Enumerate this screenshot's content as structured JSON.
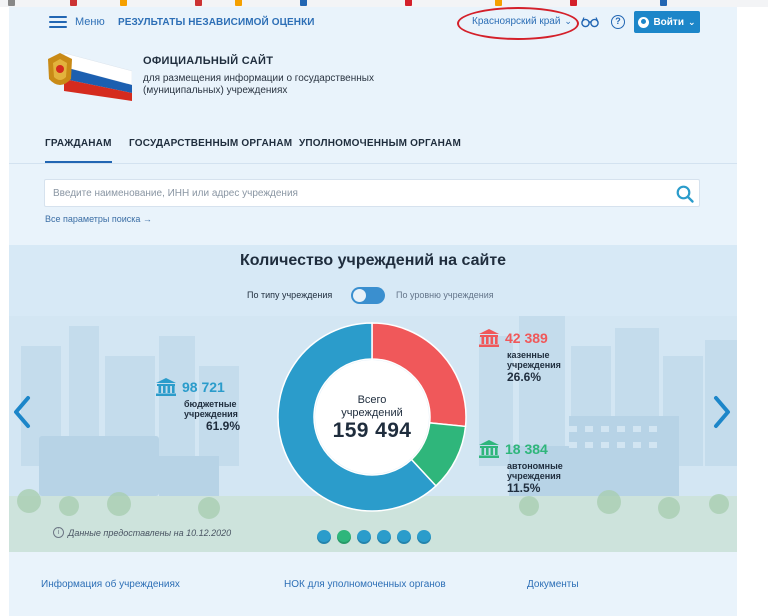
{
  "header": {
    "menu_label": "Меню",
    "results_link": "РЕЗУЛЬТАТЫ НЕЗАВИСИМОЙ ОЦЕНКИ",
    "region": "Красноярский край",
    "help_symbol": "?",
    "login_label": "Войти",
    "icons": [
      "menu-icon",
      "glasses-icon",
      "help-icon",
      "user-icon",
      "chevron-down-icon"
    ]
  },
  "branding": {
    "title": "ОФИЦИАЛЬНЫЙ САЙТ",
    "subtitle": "для размещения информации о государственных (муниципальных) учреждениях",
    "flag_colors": [
      "#ffffff",
      "#1c5fb0",
      "#d52b1e"
    ]
  },
  "nav": {
    "items": [
      {
        "label": "ГРАЖДАНАМ",
        "active": true
      },
      {
        "label": "ГОСУДАРСТВЕННЫМ ОРГАНАМ",
        "active": false
      },
      {
        "label": "УПОЛНОМОЧЕННЫМ ОРГАНАМ",
        "active": false
      }
    ]
  },
  "search": {
    "placeholder": "Введите наименование, ИНН или адрес учреждения",
    "all_params": "Все параметры поиска →"
  },
  "stats": {
    "title": "Количество учреждений на сайте",
    "toggle_left": "По типу учреждения",
    "toggle_right": "По уровню учреждения",
    "total_line1": "Всего",
    "total_line2": "учреждений",
    "total_value": "159 494",
    "segments": [
      {
        "value": "98 721",
        "label_line1": "бюджетные",
        "label_line2": "учреждения",
        "percent": "61.9%",
        "share": 61.9,
        "color": "#2b9ccb"
      },
      {
        "value": "42 389",
        "label_line1": "казенные",
        "label_line2": "учреждения",
        "percent": "26.6%",
        "share": 26.6,
        "color": "#f0585a"
      },
      {
        "value": "18 384",
        "label_line1": "автономные",
        "label_line2": "учреждения",
        "percent": "11.5%",
        "share": 11.5,
        "color": "#2fb67b"
      }
    ],
    "note": "Данные предоставлены на 10.12.2020",
    "slide_count": 6,
    "active_slide": 1
  },
  "footer": {
    "links": [
      "Информация об учреждениях",
      "НОК для уполномоченных органов",
      "Документы"
    ]
  },
  "colors": {
    "accent": "#2266b3",
    "button": "#1c86c9",
    "annotation": "#d4202a"
  }
}
